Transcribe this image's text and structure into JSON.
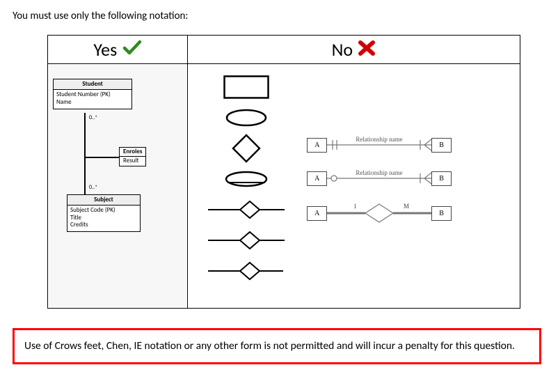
{
  "intro": "You must use only the following notation:",
  "columns": {
    "yes": "Yes",
    "no": "No"
  },
  "uml": {
    "student": {
      "title": "Student",
      "attrs": [
        "Student Number (PK)",
        "Name"
      ]
    },
    "subject": {
      "title": "Subject",
      "attrs": [
        "Subject Code (PK)",
        "Title",
        "Credits"
      ]
    },
    "assoc": {
      "name": "Enroles",
      "attr": "Result"
    },
    "mult_top": "0..*",
    "mult_bot": "0..*"
  },
  "crow": {
    "a": "A",
    "b": "B",
    "rel": "Relationship name",
    "one": "1",
    "many": "M"
  },
  "warning": "Use of Crows feet, Chen, IE notation or any other form is not permitted and will incur a penalty for this question."
}
